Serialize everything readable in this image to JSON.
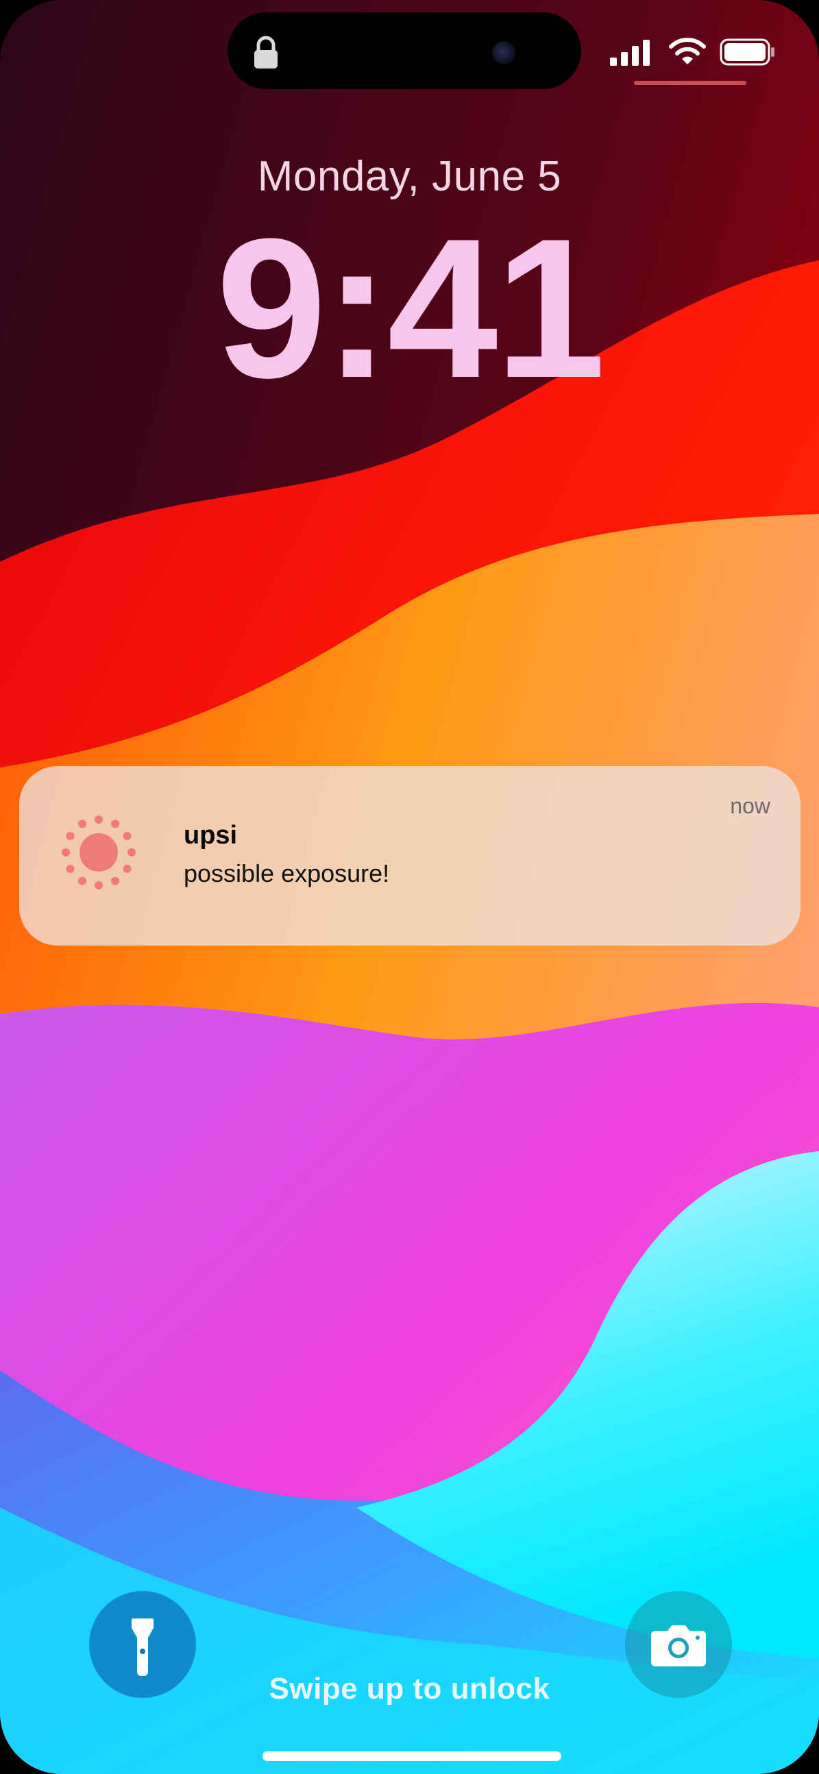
{
  "lock_screen": {
    "date": "Monday, June 5",
    "time": "9:41",
    "swipe_hint": "Swipe up to unlock"
  },
  "status_bar": {
    "icons": [
      "lock-icon",
      "signal-icon",
      "wifi-icon",
      "battery-icon"
    ]
  },
  "notification": {
    "app_name": "upsi",
    "message": "possible exposure!",
    "timestamp": "now",
    "icon": "sun-icon",
    "icon_color": "#f07a78"
  },
  "quick_actions": {
    "left_icon": "flashlight-icon",
    "right_icon": "camera-icon"
  },
  "colors": {
    "date_text": "#f3d6e6",
    "time_text": "#f8c6ea",
    "notification_bg": "#eee2de"
  }
}
